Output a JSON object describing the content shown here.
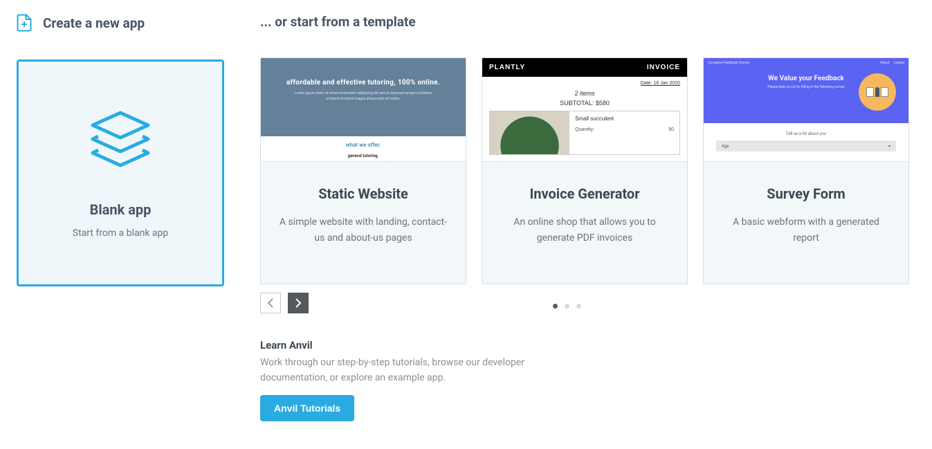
{
  "header": {
    "create_title": "Create a new app",
    "template_title": "... or start from a template"
  },
  "blank": {
    "title": "Blank app",
    "subtitle": "Start from a blank app"
  },
  "templates": [
    {
      "title": "Static Website",
      "desc": "A simple website with landing, contact-us and about-us pages",
      "thumb": {
        "headline": "affordable and effective tutoring, 100% online.",
        "offer_label": "what we offer.",
        "offer_title": "general tutoring."
      }
    },
    {
      "title": "Invoice Generator",
      "desc": "An online shop that allows you to generate PDF invoices",
      "thumb": {
        "brand": "PLANTLY",
        "doc_label": "INVOICE",
        "date": "Date: 16 Jan 2020",
        "items": "2 items",
        "subtotal": "SUBTOTAL: $580",
        "item_name": "Small succulent",
        "qty_label": "Quantity:",
        "qty_value": "50"
      }
    },
    {
      "title": "Survey Form",
      "desc": "A basic webform with a generated report",
      "thumb": {
        "brand": "Company Feedback Survey",
        "top_right_1": "About",
        "top_right_2": "Logout",
        "hero_title": "We Value your Feedback",
        "hero_sub": "Please help us out by filling in the following survey",
        "section_label": "Tell us a bit about you",
        "field_label": "Age",
        "field_caret": "▾"
      }
    }
  ],
  "carousel": {
    "active_index": 0,
    "count": 3
  },
  "learn": {
    "title": "Learn Anvil",
    "desc": "Work through our step-by-step tutorials, browse our developer documentation, or explore an example app.",
    "button": "Anvil Tutorials"
  }
}
